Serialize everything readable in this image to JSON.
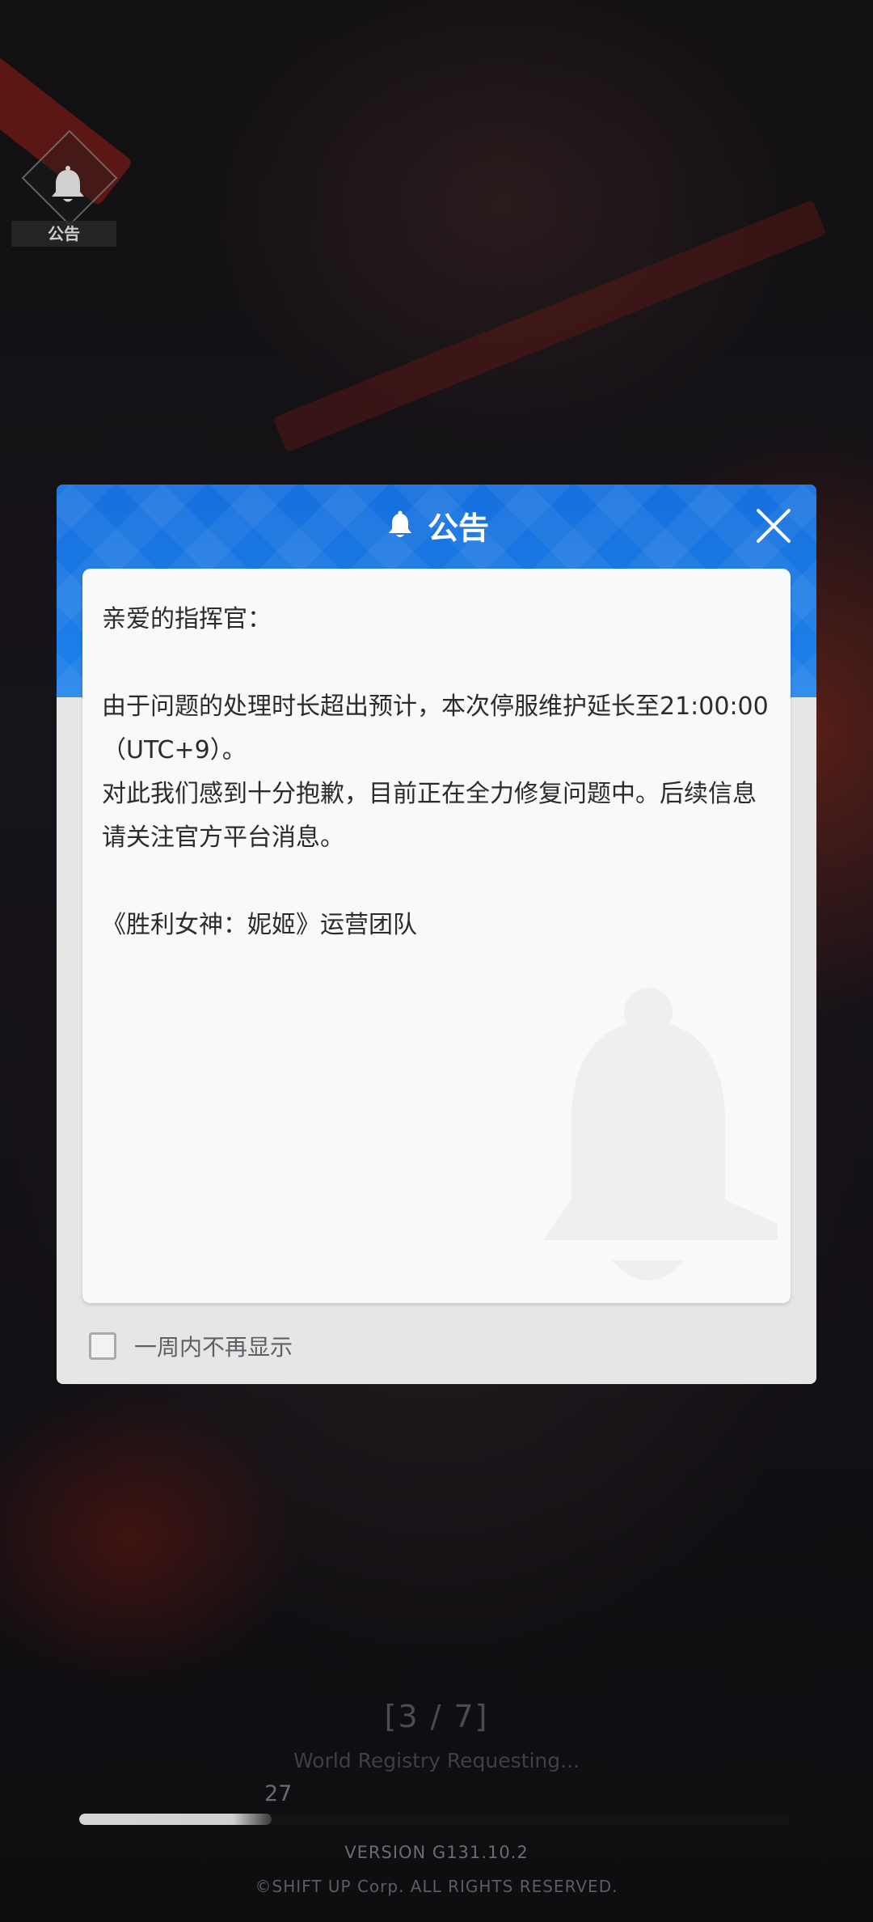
{
  "corner_notice": {
    "label": "公告",
    "icon": "bell-icon"
  },
  "modal": {
    "title": "公告",
    "title_icon": "bell-icon",
    "close_icon": "close-icon",
    "accent_color": "#1a78e6",
    "body": {
      "greeting": "亲爱的指挥官：",
      "line1": "由于问题的处理时长超出预计，本次停服维护延长至21:00:00（UTC+9）。",
      "line2": "对此我们感到十分抱歉，目前正在全力修复问题中。后续信息请关注官方平台消息。",
      "signature": "《胜利女神：妮姬》运营团队"
    },
    "checkbox": {
      "label": "一周内不再显示",
      "checked": false
    }
  },
  "loading": {
    "step": "[3 / 7]",
    "status": "World Registry Requesting...",
    "progress_value": "27",
    "progress_fraction": 0.27
  },
  "footer": {
    "version": "VERSION   G131.10.2",
    "copyright": "©SHIFT UP Corp. ALL RIGHTS  RESERVED."
  }
}
